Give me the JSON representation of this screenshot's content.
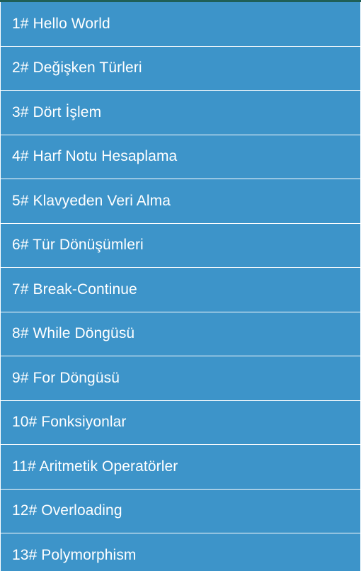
{
  "colors": {
    "item_background": "#3d94c9",
    "item_text": "#ffffff",
    "top_strip": "#1f5f57",
    "divider": "#ffffff"
  },
  "list": {
    "items": [
      {
        "label": "1# Hello World"
      },
      {
        "label": "2# Değişken Türleri"
      },
      {
        "label": "3# Dört İşlem"
      },
      {
        "label": "4# Harf Notu Hesaplama"
      },
      {
        "label": "5# Klavyeden Veri Alma"
      },
      {
        "label": "6# Tür Dönüşümleri"
      },
      {
        "label": "7# Break-Continue"
      },
      {
        "label": "8# While Döngüsü"
      },
      {
        "label": "9# For Döngüsü"
      },
      {
        "label": "10# Fonksiyonlar"
      },
      {
        "label": "11# Aritmetik Operatörler"
      },
      {
        "label": "12# Overloading"
      },
      {
        "label": "13# Polymorphism"
      }
    ]
  }
}
